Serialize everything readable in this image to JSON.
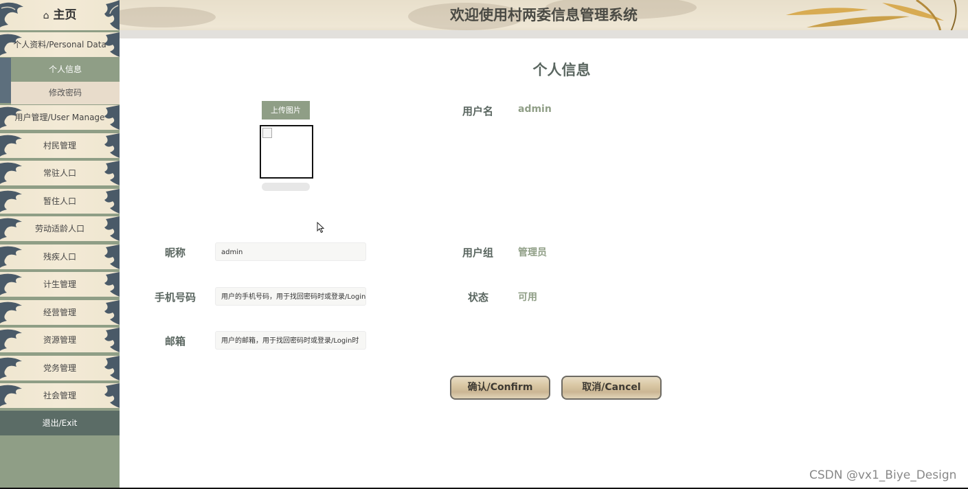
{
  "header": {
    "title": "欢迎使用村两委信息管理系统"
  },
  "sidebar": {
    "home": {
      "icon": "home-icon",
      "glyph": "⌂",
      "label": "主页"
    },
    "personal_group": "个人资料/Personal Data",
    "personal_sub": [
      "个人信息",
      "修改密码"
    ],
    "items": [
      "用户管理/User Manage",
      "村民管理",
      "常驻人口",
      "暂住人口",
      "劳动适龄人口",
      "残疾人口",
      "计生管理",
      "经营管理",
      "资源管理",
      "党务管理",
      "社会管理"
    ],
    "exit": "退出/Exit"
  },
  "main": {
    "title": "个人信息",
    "upload_button": "上传图片",
    "username_label": "用户名",
    "username_value": "admin",
    "nickname_label": "昵称",
    "nickname_value": "admin",
    "group_label": "用户组",
    "group_value": "管理员",
    "phone_label": "手机号码",
    "phone_placeholder": "用户的手机号码，用于找回密码时或登录/Login时",
    "status_label": "状态",
    "status_value": "可用",
    "email_label": "邮箱",
    "email_placeholder": "用户的邮箱，用于找回密码时或登录/Login时",
    "confirm": "确认/Confirm",
    "cancel": "取消/Cancel"
  },
  "watermark": "CSDN @vx1_Biye_Design",
  "colors": {
    "sidebar_bg": "#8f9e86",
    "accent": "#8f9e86",
    "label": "#5a6660",
    "exit_bg": "#5b6c66",
    "wave": "#4a5a68"
  }
}
